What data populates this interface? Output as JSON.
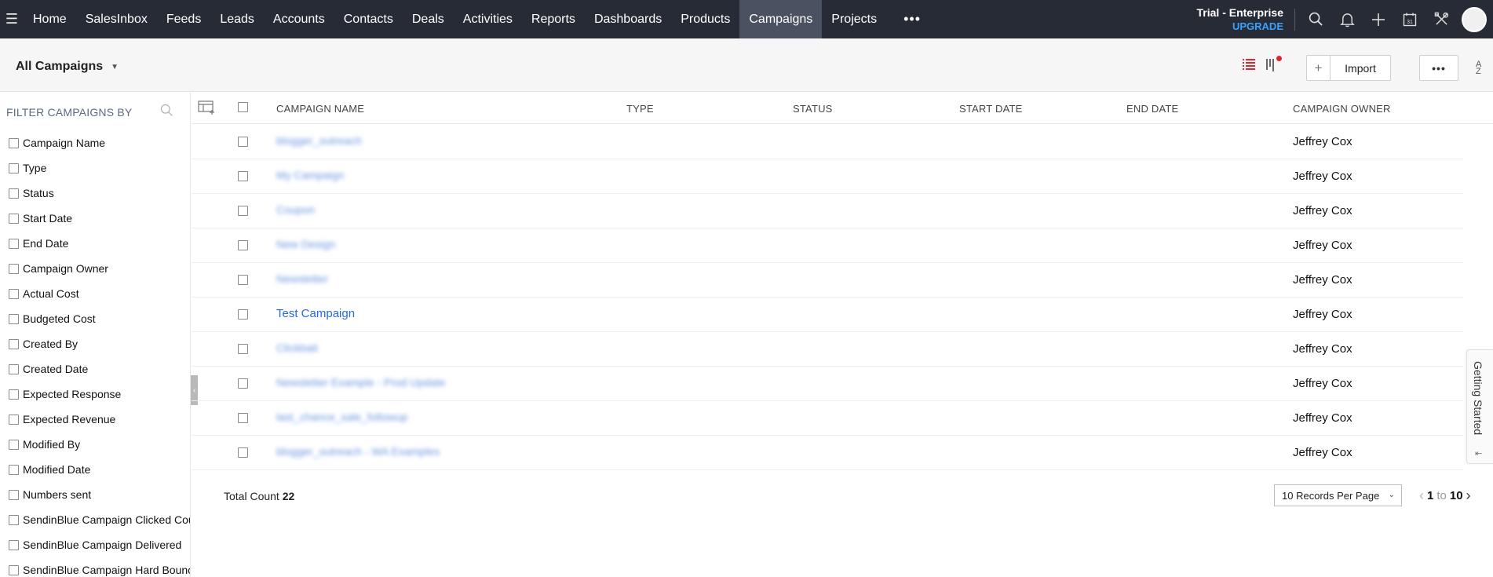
{
  "topnav": {
    "menu_icon": "hamburger-icon",
    "items": [
      "Home",
      "SalesInbox",
      "Feeds",
      "Leads",
      "Accounts",
      "Contacts",
      "Deals",
      "Activities",
      "Reports",
      "Dashboards",
      "Products",
      "Campaigns",
      "Projects"
    ],
    "active": "Campaigns",
    "more_label": "•••",
    "trial_label": "Trial - Enterprise",
    "upgrade_label": "UPGRADE",
    "icons": [
      "search-icon",
      "bell-icon",
      "plus-icon",
      "calendar-icon",
      "tools-icon",
      "avatar"
    ],
    "calendar_day": "31"
  },
  "subheader": {
    "view_label": "All Campaigns",
    "import_plus": "+",
    "import_label": "Import",
    "more_label": "•••",
    "sort_top": "A",
    "sort_bottom": "Z"
  },
  "sidebar": {
    "title": "FILTER CAMPAIGNS BY",
    "filters": [
      "Campaign Name",
      "Type",
      "Status",
      "Start Date",
      "End Date",
      "Campaign Owner",
      "Actual Cost",
      "Budgeted Cost",
      "Created By",
      "Created Date",
      "Expected Response",
      "Expected Revenue",
      "Modified By",
      "Modified Date",
      "Numbers sent",
      "SendinBlue Campaign Clicked Count",
      "SendinBlue Campaign Delivered",
      "SendinBlue Campaign Hard Bounce"
    ]
  },
  "table": {
    "columns": [
      "CAMPAIGN NAME",
      "TYPE",
      "STATUS",
      "START DATE",
      "END DATE",
      "CAMPAIGN OWNER"
    ],
    "rows": [
      {
        "name": "blogger_outreach",
        "blurred": true,
        "owner": "Jeffrey Cox"
      },
      {
        "name": "My Campaign",
        "blurred": true,
        "owner": "Jeffrey Cox"
      },
      {
        "name": "Coupon",
        "blurred": true,
        "owner": "Jeffrey Cox"
      },
      {
        "name": "New Design",
        "blurred": true,
        "owner": "Jeffrey Cox"
      },
      {
        "name": "Newsletter",
        "blurred": true,
        "owner": "Jeffrey Cox"
      },
      {
        "name": "Test Campaign",
        "blurred": false,
        "owner": "Jeffrey Cox"
      },
      {
        "name": "Clickbait",
        "blurred": true,
        "owner": "Jeffrey Cox"
      },
      {
        "name": "Newsletter Example - Prod Update",
        "blurred": true,
        "owner": "Jeffrey Cox"
      },
      {
        "name": "last_chance_sale_followup",
        "blurred": true,
        "owner": "Jeffrey Cox"
      },
      {
        "name": "blogger_outreach - WA Examples",
        "blurred": true,
        "owner": "Jeffrey Cox"
      }
    ]
  },
  "footer": {
    "total_label": "Total Count",
    "total_value": "22",
    "per_page": "10 Records Per Page",
    "page_from": "1",
    "page_to_label": "to",
    "page_to": "10"
  },
  "getting_started": {
    "label": "Getting Started"
  },
  "colors": {
    "nav_bg": "#262b36",
    "nav_active": "#4a5160",
    "link": "#2a6ad6",
    "upgrade": "#3aa0ff",
    "notification_dot": "#e0262d"
  }
}
